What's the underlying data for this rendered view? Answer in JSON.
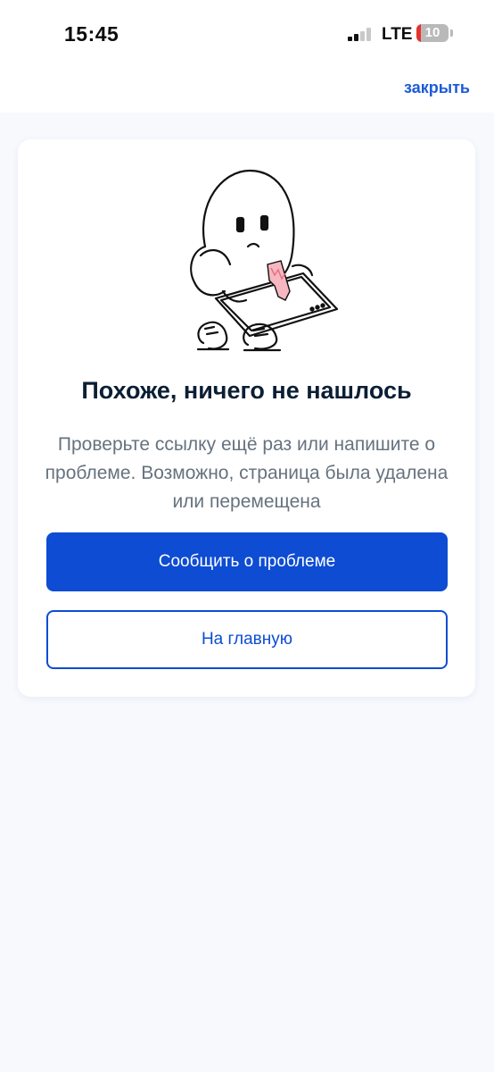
{
  "status_bar": {
    "time": "15:45",
    "network": "LTE",
    "battery_level": "10",
    "battery_color": "#e5332a"
  },
  "nav": {
    "close_label": "закрыть"
  },
  "error": {
    "illustration_icon": "sad-character-holding-torn-card",
    "title": "Похоже, ничего не нашлось",
    "description": "Проверьте ссылку ещё раз или напишите о проблеме. Возможно, страница была удалена или перемещена",
    "report_button": "Сообщить о проблеме",
    "home_button": "На главную"
  },
  "colors": {
    "accent": "#0d4cd3",
    "link": "#1c5bd8",
    "title": "#0b1f33",
    "description": "#66727f",
    "background": "#f7f9fd"
  }
}
